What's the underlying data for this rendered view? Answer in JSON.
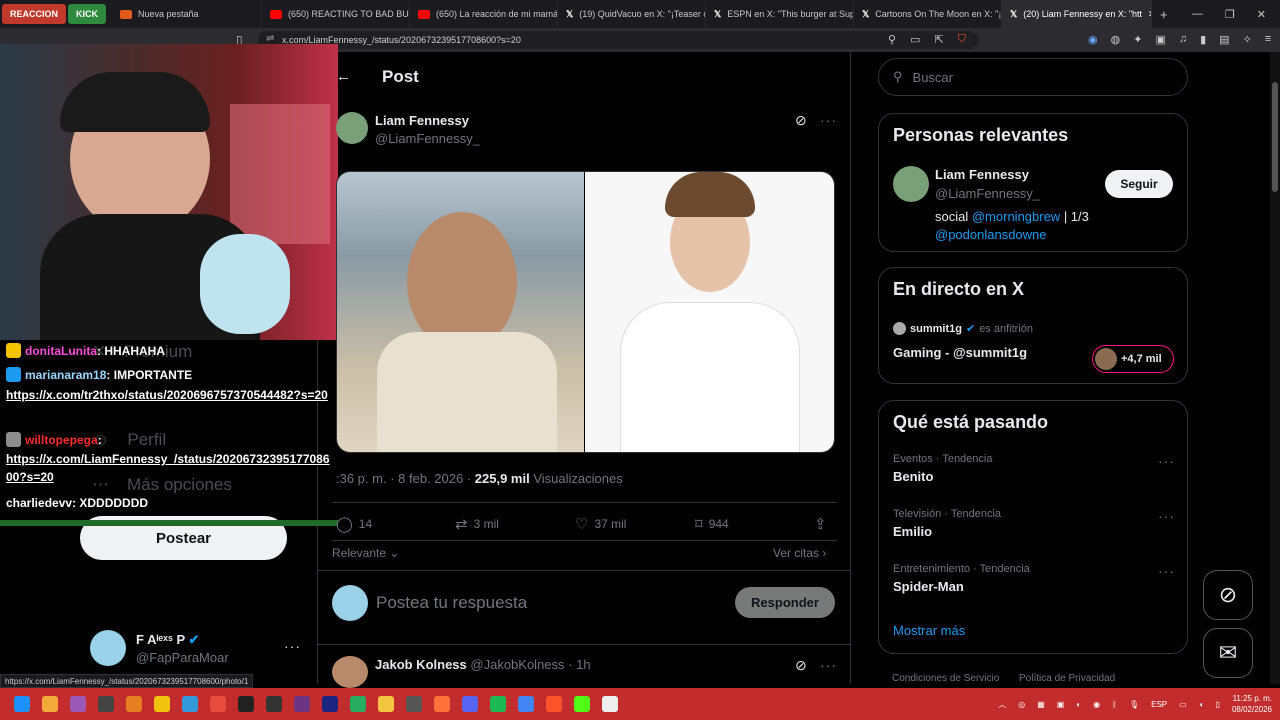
{
  "browser": {
    "tag_reaccion": "REACCION",
    "tag_kick": "KICK",
    "tabs": [
      {
        "label": "Nueva pestaña",
        "color": "#e25a1c"
      },
      {
        "label": "(650) REACTING TO BAD BUNNY",
        "color": "#ff0000"
      },
      {
        "label": "(650) La reacción de mi mamá al",
        "color": "#ff0000"
      },
      {
        "label": "(19) QuidVacuo en X: \"¡Teaser de",
        "color": "#ffffff"
      },
      {
        "label": "ESPN en X: \"This burger at Super",
        "color": "#ffffff"
      },
      {
        "label": "Cartoons On The Moon en X: \"¡El",
        "color": "#ffffff"
      },
      {
        "label": "(20) Liam Fennessy en X: \"htt",
        "color": "#ffffff"
      }
    ],
    "url": "x.com/LiamFennessy_/status/2020673239517708600?s=20",
    "status_link": "https://x.com/LiamFennessy_/status/2020673239517708600/photo/1"
  },
  "sidebar": {
    "items": [
      "Premium",
      "Perfil",
      "Más opciones"
    ],
    "post_button": "Postear",
    "account_name": "F Aˡᵉˣˢ P",
    "account_handle": "@FapParaMoar"
  },
  "chat": [
    {
      "user": "donitaLunita",
      "message": "HHAHAHA",
      "user_color": "#ff4fd8",
      "badge_color": "#f5c400"
    },
    {
      "user": "marianaram18",
      "message": "IMPORTANTE",
      "user_color": "#9ad7ff",
      "badge_color": "#1d9bf0"
    },
    {
      "user": "",
      "message": "https://x.com/tr2thxo/status/2020696757370544482?s=20",
      "user_color": "#ffffff",
      "badge_color": ""
    },
    {
      "user": "willtopepega",
      "message": "",
      "user_color": "#ff2a2a",
      "badge_color": "#8c8c8c"
    },
    {
      "user": "",
      "message": "https://x.com/LiamFennessy_/status/2020673239517708600?s=20",
      "user_color": "#ffffff",
      "badge_color": ""
    },
    {
      "user": "charliedevv",
      "message": "XDDDDDDD",
      "user_color": "#ffffff",
      "badge_color": ""
    }
  ],
  "post": {
    "header": "Post",
    "author_name": "Liam Fennessy",
    "author_handle": "@LiamFennessy_",
    "time": ":36 p. m. · 8 feb. 2026 ·",
    "views_count": "225,9 mil",
    "views_label": "Visualizaciones",
    "replies": "14",
    "reposts": "3 mil",
    "likes": "37 mil",
    "bookmarks": "944",
    "sort_label": "Relevante",
    "quotes_label": "Ver citas",
    "reply_placeholder": "Postea tu respuesta",
    "reply_button": "Responder"
  },
  "next_reply": {
    "name": "Jakob Kolness",
    "handle": "@JakobKolness",
    "time": "· 1h"
  },
  "right": {
    "search_placeholder": "Buscar",
    "relevant": {
      "title": "Personas relevantes",
      "name": "Liam Fennessy",
      "handle": "@LiamFennessy_",
      "follow": "Seguir",
      "bio_prefix": "social ",
      "bio_link1": "@morningbrew",
      "bio_mid": " | 1/3",
      "bio_link2": "@podonlansdowne"
    },
    "live": {
      "title": "En directo en X",
      "host": "summit1g",
      "host_label": "es anfitrión",
      "space": "Gaming - @summit1g",
      "listeners": "+4,7 mil"
    },
    "trending": {
      "title": "Qué está pasando",
      "items": [
        {
          "category": "Eventos · Tendencia",
          "name": "Benito"
        },
        {
          "category": "Televisión · Tendencia",
          "name": "Emilio"
        },
        {
          "category": "Entretenimiento · Tendencia",
          "name": "Spider-Man"
        }
      ],
      "more": "Mostrar más"
    },
    "footer_terms": "Condiciones de Servicio",
    "footer_privacy": "Política de Privacidad"
  },
  "taskbar": {
    "lang": "ESP",
    "time": "11:25 p. m.",
    "date": "08/02/2026"
  }
}
